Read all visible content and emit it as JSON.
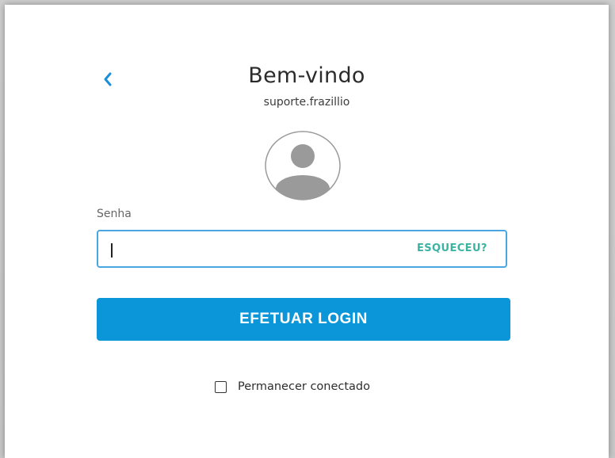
{
  "header": {
    "title": "Bem-vindo",
    "username": "suporte.frazillio"
  },
  "password": {
    "label": "Senha",
    "value": "",
    "forgot_label": "ESQUECEU?"
  },
  "actions": {
    "login_label": "EFETUAR LOGIN"
  },
  "remember": {
    "label": "Permanecer conectado",
    "checked": false
  },
  "colors": {
    "accent": "#0a96d8",
    "focus_border": "#4aa6e0",
    "forgot_link": "#3bb3a3",
    "back_arrow": "#1a8fd6"
  },
  "icons": {
    "back": "chevron-left-icon",
    "avatar": "user-avatar-icon"
  }
}
